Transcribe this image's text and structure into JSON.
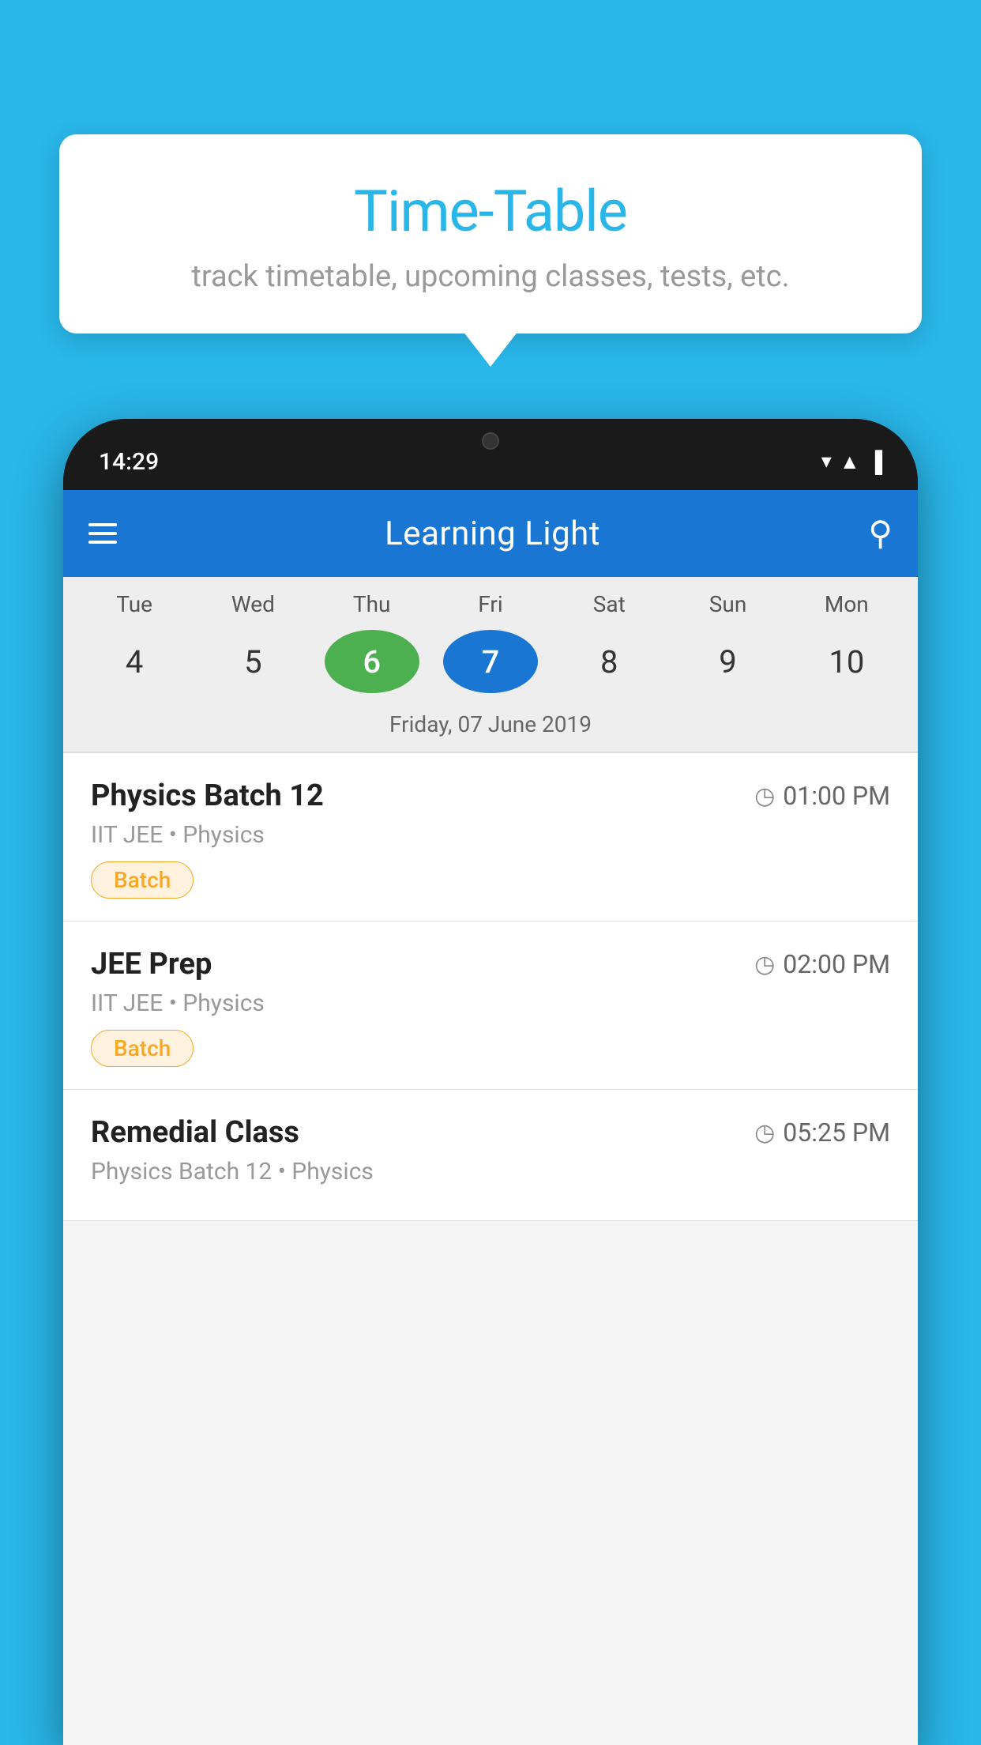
{
  "background_color": "#29b6e8",
  "tooltip": {
    "title": "Time-Table",
    "subtitle": "track timetable, upcoming classes, tests, etc."
  },
  "phone": {
    "status_bar": {
      "time": "14:29"
    },
    "app_header": {
      "title": "Learning Light"
    },
    "calendar": {
      "days": [
        {
          "name": "Tue",
          "number": "4",
          "state": "normal"
        },
        {
          "name": "Wed",
          "number": "5",
          "state": "normal"
        },
        {
          "name": "Thu",
          "number": "6",
          "state": "today"
        },
        {
          "name": "Fri",
          "number": "7",
          "state": "selected"
        },
        {
          "name": "Sat",
          "number": "8",
          "state": "normal"
        },
        {
          "name": "Sun",
          "number": "9",
          "state": "normal"
        },
        {
          "name": "Mon",
          "number": "10",
          "state": "normal"
        }
      ],
      "selected_date_label": "Friday, 07 June 2019"
    },
    "schedule": [
      {
        "title": "Physics Batch 12",
        "time": "01:00 PM",
        "subtitle": "IIT JEE • Physics",
        "badge": "Batch"
      },
      {
        "title": "JEE Prep",
        "time": "02:00 PM",
        "subtitle": "IIT JEE • Physics",
        "badge": "Batch"
      },
      {
        "title": "Remedial Class",
        "time": "05:25 PM",
        "subtitle": "Physics Batch 12 • Physics",
        "badge": null
      }
    ]
  }
}
